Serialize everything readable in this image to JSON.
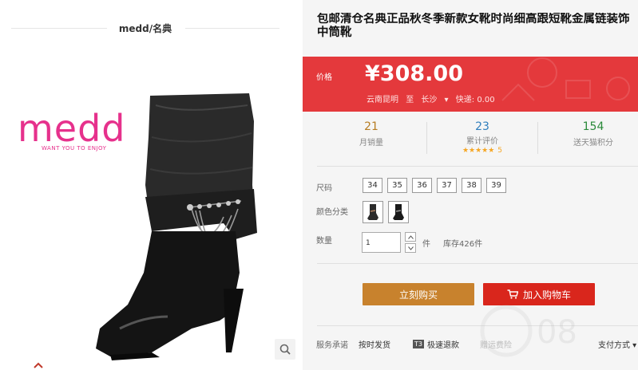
{
  "brand": {
    "title": "medd/名典",
    "logo_text": "medd",
    "logo_tagline": "WANT YOU TO ENJOY"
  },
  "product": {
    "title_line1": "包邮清仓名典正品秋冬季新款女靴时尚细高跟短靴金属链装饰",
    "title_line2": "中筒靴"
  },
  "price": {
    "label": "价格",
    "value": "¥308.00",
    "ship_from": "云南昆明",
    "ship_to_word": "至",
    "ship_to": "长沙",
    "express": "快递: 0.00"
  },
  "stats": [
    {
      "value": "21",
      "label": "月销量",
      "color": "#b67c22"
    },
    {
      "value": "23",
      "label": "累计评价",
      "color": "#2f7ebd",
      "stars": "★★★★★",
      "star_count": "5"
    },
    {
      "value": "154",
      "label": "送天猫积分",
      "color": "#2a8a3a"
    }
  ],
  "options": {
    "size_label": "尺码",
    "sizes": [
      "34",
      "35",
      "36",
      "37",
      "38",
      "39"
    ],
    "color_label": "颜色分类",
    "qty_label": "数量",
    "qty_value": "1",
    "qty_unit": "件",
    "stock": "库存426件"
  },
  "actions": {
    "buy_now": "立刻购买",
    "add_cart": "加入购物车"
  },
  "services": {
    "label": "服务承诺",
    "items": [
      "按时发货",
      "极速退款",
      "赠运费险"
    ],
    "t3_badge": "T3",
    "payment": "支付方式"
  },
  "watermark": "08"
}
